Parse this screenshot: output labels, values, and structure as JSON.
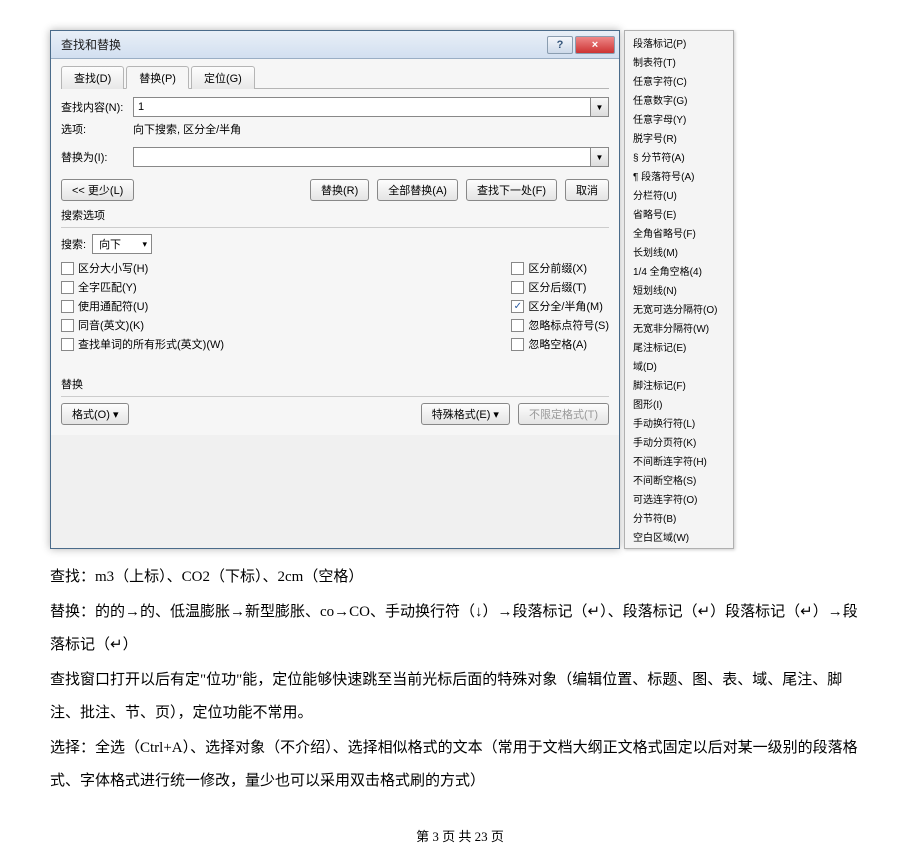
{
  "dialog": {
    "title": "查找和替换",
    "tabs": {
      "find": "查找(D)",
      "replace": "替换(P)",
      "goto": "定位(G)"
    },
    "find_label": "查找内容(N):",
    "find_value": "1",
    "options_label": "选项:",
    "options_text": "向下搜索, 区分全/半角",
    "replace_label": "替换为(I):",
    "replace_value": "",
    "buttons": {
      "less": "<< 更少(L)",
      "replace": "替换(R)",
      "replace_all": "全部替换(A)",
      "find_next": "查找下一处(F)",
      "cancel": "取消"
    },
    "search_options_title": "搜索选项",
    "search_label": "搜索:",
    "search_direction": "向下",
    "checks_left": [
      {
        "label": "区分大小写(H)",
        "checked": false
      },
      {
        "label": "全字匹配(Y)",
        "checked": false
      },
      {
        "label": "使用通配符(U)",
        "checked": false
      },
      {
        "label": "同音(英文)(K)",
        "checked": false
      },
      {
        "label": "查找单词的所有形式(英文)(W)",
        "checked": false
      }
    ],
    "checks_right": [
      {
        "label": "区分前缀(X)",
        "checked": false
      },
      {
        "label": "区分后缀(T)",
        "checked": false
      },
      {
        "label": "区分全/半角(M)",
        "checked": true
      },
      {
        "label": "忽略标点符号(S)",
        "checked": false
      },
      {
        "label": "忽略空格(A)",
        "checked": false
      }
    ],
    "replace_section_title": "替换",
    "format_btn": "格式(O) ▾",
    "special_btn": "特殊格式(E) ▾",
    "noformat_btn": "不限定格式(T)"
  },
  "sidemenu": [
    "段落标记(P)",
    "制表符(T)",
    "任意字符(C)",
    "任意数字(G)",
    "任意字母(Y)",
    "脱字号(R)",
    "§ 分节符(A)",
    "¶ 段落符号(A)",
    "分栏符(U)",
    "省略号(E)",
    "全角省略号(F)",
    "长划线(M)",
    "1/4 全角空格(4)",
    "短划线(N)",
    "无宽可选分隔符(O)",
    "无宽非分隔符(W)",
    "尾注标记(E)",
    "域(D)",
    "脚注标记(F)",
    "图形(I)",
    "手动换行符(L)",
    "手动分页符(K)",
    "不间断连字符(H)",
    "不间断空格(S)",
    "可选连字符(O)",
    "分节符(B)",
    "空白区域(W)"
  ],
  "body": {
    "p1": "查找：m3（上标）、CO2（下标）、2cm（空格）",
    "p2": "替换：的的→的、低温膨胀→新型膨胀、co→CO、手动换行符（↓）→段落标记（↵）、段落标记（↵）段落标记（↵）→段落标记（↵）",
    "p3": "查找窗口打开以后有定\"位功\"能，定位能够快速跳至当前光标后面的特殊对象（编辑位置、标题、图、表、域、尾注、脚注、批注、节、页），定位功能不常用。",
    "p4": "选择：全选（Ctrl+A）、选择对象（不介绍）、选择相似格式的文本（常用于文档大纲正文格式固定以后对某一级别的段落格式、字体格式进行统一修改，量少也可以采用双击格式刷的方式）"
  },
  "footer": "第 3 页 共 23 页"
}
